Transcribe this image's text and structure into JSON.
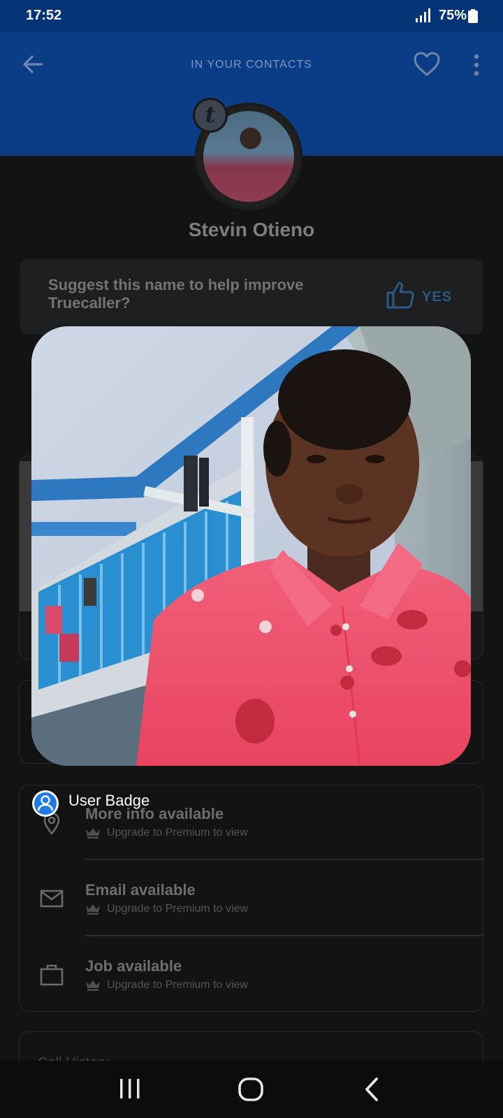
{
  "status_bar": {
    "time": "17:52",
    "battery": "75%"
  },
  "header": {
    "title": "IN YOUR CONTACTS"
  },
  "avatar": {
    "badge_letter": "t"
  },
  "contact": {
    "name": "Stevin Otieno"
  },
  "suggest": {
    "text": "Suggest this name to help improve Truecaller?",
    "yes_label": "YES"
  },
  "overlay": {
    "user_badge_label": "User Badge"
  },
  "info_items": [
    {
      "title": "More info available",
      "subtitle": "Upgrade to Premium to view"
    },
    {
      "title": "Email available",
      "subtitle": "Upgrade to Premium to view"
    },
    {
      "title": "Job available",
      "subtitle": "Upgrade to Premium to view"
    }
  ],
  "call_history": {
    "label": "Call History"
  },
  "colors": {
    "header_blue": "#0a3d85",
    "status_blue": "#053476",
    "background": "#131313",
    "badge_blue": "#1e7be8"
  }
}
